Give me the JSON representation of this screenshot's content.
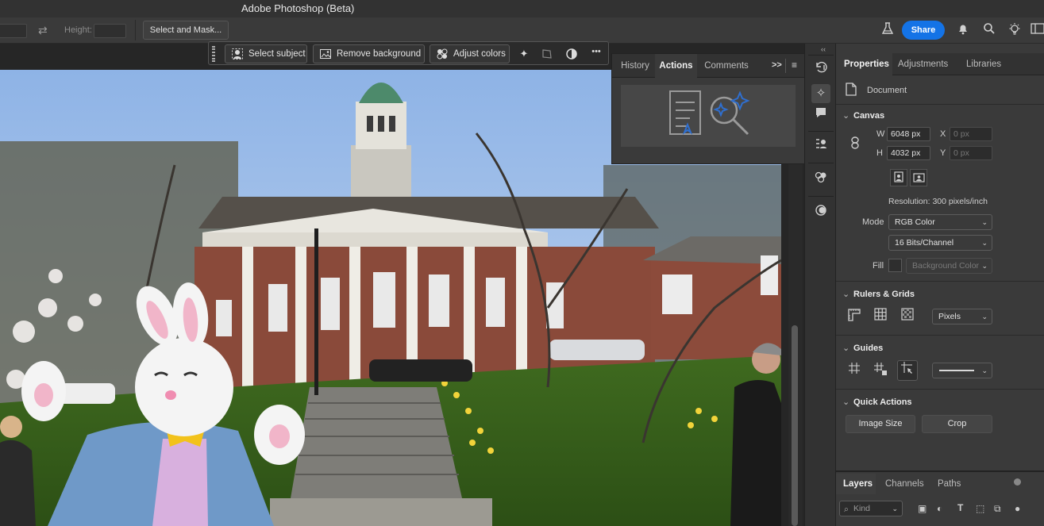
{
  "window": {
    "title": "Adobe Photoshop (Beta)"
  },
  "options_bar": {
    "height_label": "Height:",
    "select_mask_label": "Select and Mask...",
    "share_label": "Share"
  },
  "context_bar": {
    "select_subject": "Select subject",
    "remove_background": "Remove background",
    "adjust_colors": "Adjust colors",
    "more": "•••"
  },
  "floating_panel": {
    "tabs": [
      {
        "label": "History"
      },
      {
        "label": "Actions"
      },
      {
        "label": "Comments"
      }
    ],
    "active_tab": "Actions",
    "expand_label": ">>"
  },
  "properties": {
    "tabs": [
      {
        "label": "Properties"
      },
      {
        "label": "Adjustments"
      },
      {
        "label": "Libraries"
      }
    ],
    "active_tab": "Properties",
    "document_label": "Document",
    "canvas": {
      "header": "Canvas",
      "w_label": "W",
      "w_value": "6048 px",
      "h_label": "H",
      "h_value": "4032 px",
      "x_label": "X",
      "x_placeholder": "0 px",
      "y_label": "Y",
      "y_placeholder": "0 px",
      "resolution": "Resolution: 300 pixels/inch",
      "mode_label": "Mode",
      "mode_value": "RGB Color",
      "depth_value": "16 Bits/Channel",
      "fill_label": "Fill",
      "fill_value": "Background Color"
    },
    "rulers": {
      "header": "Rulers & Grids",
      "units": "Pixels"
    },
    "guides": {
      "header": "Guides"
    },
    "quick_actions": {
      "header": "Quick Actions",
      "image_size": "Image Size",
      "crop": "Crop"
    }
  },
  "layers_panel": {
    "tabs": [
      {
        "label": "Layers"
      },
      {
        "label": "Channels"
      },
      {
        "label": "Paths"
      }
    ],
    "active_tab": "Layers",
    "filter_placeholder": "Kind"
  },
  "colors": {
    "accent": "#1473e6",
    "panel_bg": "#3a3a3a",
    "panel_dark": "#323232",
    "canvas_bg": "#262626"
  }
}
